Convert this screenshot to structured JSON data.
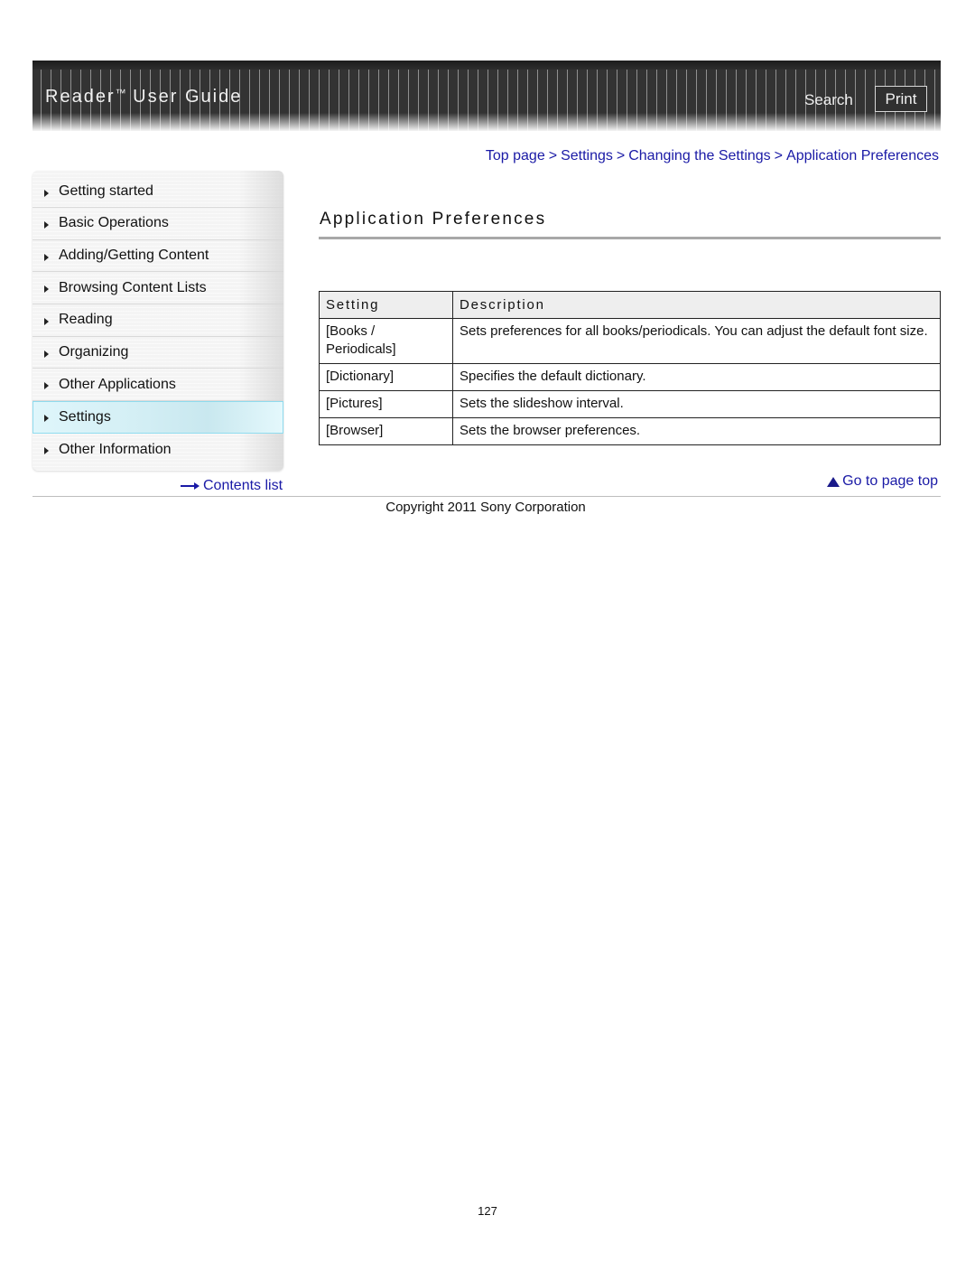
{
  "header": {
    "title": "Reader",
    "trademark": "™",
    "title_suffix": "User Guide",
    "search_label": "Search",
    "print_label": "Print"
  },
  "breadcrumb": {
    "items": [
      "Top page",
      "Settings",
      "Changing the Settings",
      "Application Preferences"
    ],
    "separator": ">"
  },
  "sidebar": {
    "items": [
      {
        "label": "Getting started",
        "active": false
      },
      {
        "label": "Basic Operations",
        "active": false
      },
      {
        "label": "Adding/Getting Content",
        "active": false
      },
      {
        "label": "Browsing Content Lists",
        "active": false
      },
      {
        "label": "Reading",
        "active": false
      },
      {
        "label": "Organizing",
        "active": false
      },
      {
        "label": "Other Applications",
        "active": false
      },
      {
        "label": "Settings",
        "active": true
      },
      {
        "label": "Other Information",
        "active": false
      }
    ],
    "contents_link": "Contents list",
    "active_color": "#d4eff5"
  },
  "main": {
    "title": "Application Preferences",
    "table": {
      "headers": [
        "Setting",
        "Description"
      ],
      "rows": [
        {
          "setting": "[Books / Periodicals]",
          "description": "Sets preferences for all books/periodicals. You can adjust the default font size."
        },
        {
          "setting": "[Dictionary]",
          "description": "Specifies the default dictionary."
        },
        {
          "setting": "[Pictures]",
          "description": "Sets the slideshow interval."
        },
        {
          "setting": "[Browser]",
          "description": "Sets the browser preferences."
        }
      ]
    },
    "page_top_link": "Go to page top"
  },
  "footer": {
    "copyright": "Copyright 2011 Sony Corporation",
    "page_number": "127"
  },
  "colors": {
    "link": "#1a1aa6",
    "header_bg": "#333333"
  }
}
